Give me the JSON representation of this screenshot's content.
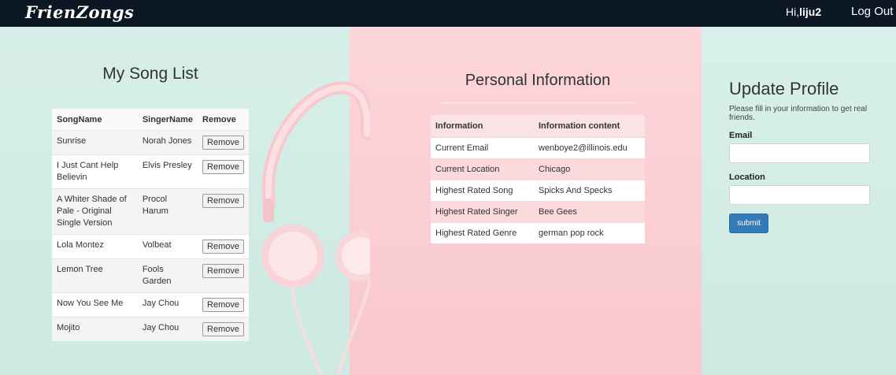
{
  "nav": {
    "brand": "FrienZongs",
    "greeting_prefix": "Hi,",
    "username": "liju2",
    "logout_label": "Log Out"
  },
  "song_list": {
    "title": "My Song List",
    "headers": [
      "SongName",
      "SingerName",
      "Remove"
    ],
    "remove_label": "Remove",
    "rows": [
      {
        "song": "Sunrise",
        "singer": "Norah Jones"
      },
      {
        "song": "I Just Cant Help Believin",
        "singer": "Elvis Presley"
      },
      {
        "song": "A Whiter Shade of Pale - Original Single Version",
        "singer": "Procol Harum"
      },
      {
        "song": "Lola Montez",
        "singer": "Volbeat"
      },
      {
        "song": "Lemon Tree",
        "singer": "Fools Garden"
      },
      {
        "song": "Now You See Me",
        "singer": "Jay Chou"
      },
      {
        "song": "Mojito",
        "singer": "Jay Chou"
      }
    ]
  },
  "personal_info": {
    "title": "Personal Information",
    "headers": [
      "Information",
      "Information content"
    ],
    "rows": [
      {
        "label": "Current Email",
        "value": "wenboye2@illinois.edu"
      },
      {
        "label": "Current Location",
        "value": "Chicago"
      },
      {
        "label": "Highest Rated Song",
        "value": "Spicks And Specks"
      },
      {
        "label": "Highest Rated Singer",
        "value": "Bee Gees"
      },
      {
        "label": "Highest Rated Genre",
        "value": "german pop rock"
      }
    ]
  },
  "update_profile": {
    "title": "Update Profile",
    "description": "Please fill in your information to get real friends.",
    "email_label": "Email",
    "email_value": "",
    "location_label": "Location",
    "location_value": "",
    "submit_label": "submit"
  },
  "colors": {
    "navbar": "#0b1722",
    "mint": "#d7efe8",
    "pink": "#fcd6da",
    "button": "#337ab7"
  }
}
